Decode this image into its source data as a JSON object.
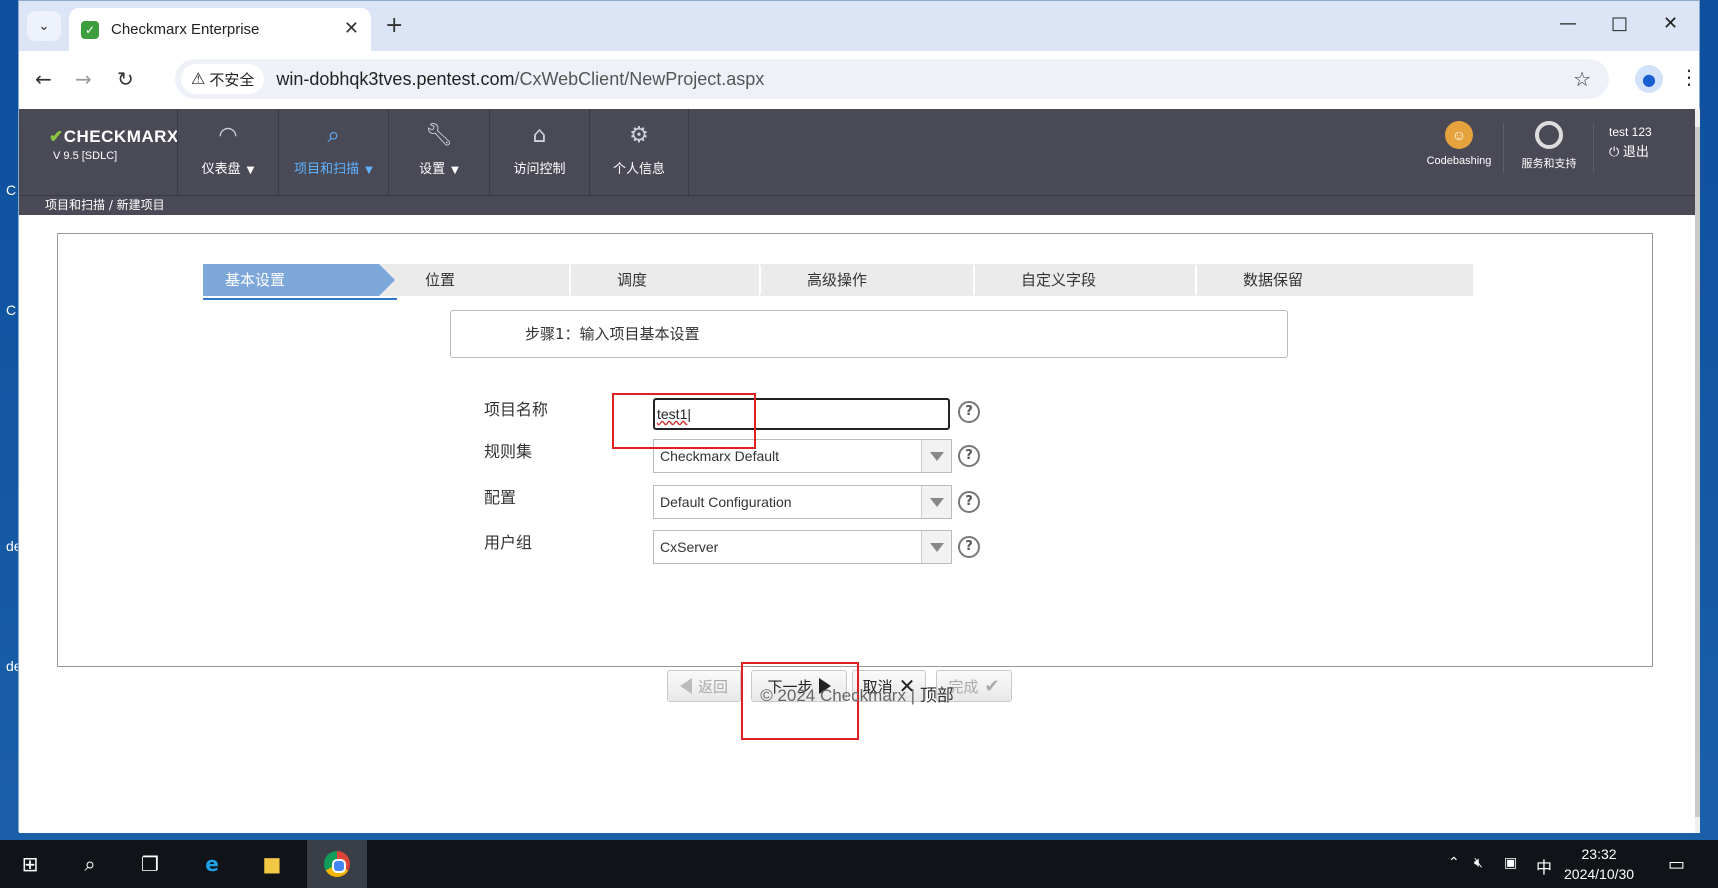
{
  "desktop": {
    "side_labels": [
      "C",
      "C",
      "de",
      "de"
    ]
  },
  "browser": {
    "tab_title": "Checkmarx Enterprise",
    "security_label": "不安全",
    "url_host": "win-dobhqk3tves.pentest.com",
    "url_path": "/CxWebClient/NewProject.aspx"
  },
  "app": {
    "logo_text": "CHECKMARX",
    "version": "V 9.5   [SDLC]",
    "nav": [
      {
        "label": "仪表盘",
        "icon": "gauge-icon",
        "has_caret": true
      },
      {
        "label": "项目和扫描",
        "icon": "project-search-icon",
        "has_caret": true,
        "active": true
      },
      {
        "label": "设置",
        "icon": "wrench-icon",
        "has_caret": true
      },
      {
        "label": "访问控制",
        "icon": "access-control-icon",
        "has_caret": false
      },
      {
        "label": "个人信息",
        "icon": "user-gear-icon",
        "has_caret": false
      }
    ],
    "codebashing_label": "Codebashing",
    "support_label": "服务和支持",
    "user_name": "test 123",
    "logout_label": "退出",
    "breadcrumb": "项目和扫描 / 新建项目"
  },
  "wizard": {
    "steps": [
      "基本设置",
      "位置",
      "调度",
      "高级操作",
      "自定义字段",
      "数据保留"
    ],
    "active_step": 0,
    "hint": "步骤1：输入项目基本设置",
    "fields": {
      "project_name_label": "项目名称",
      "project_name_value": "test1",
      "ruleset_label": "规则集",
      "ruleset_value": "Checkmarx Default",
      "config_label": "配置",
      "config_value": "Default Configuration",
      "usergroup_label": "用户组",
      "usergroup_value": "CxServer"
    },
    "buttons": {
      "back": "返回",
      "next": "下一步",
      "cancel": "取消",
      "finish": "完成"
    }
  },
  "footer": {
    "copyright": "© 2024 Checkmarx | ",
    "top_link": "顶部"
  },
  "taskbar": {
    "ime": "中",
    "time": "23:32",
    "date": "2024/10/30"
  },
  "colors": {
    "header_bg": "#4a4a57",
    "active_step": "#7da7d9",
    "nav_active": "#5eb1ff",
    "highlight": "#e02020"
  }
}
